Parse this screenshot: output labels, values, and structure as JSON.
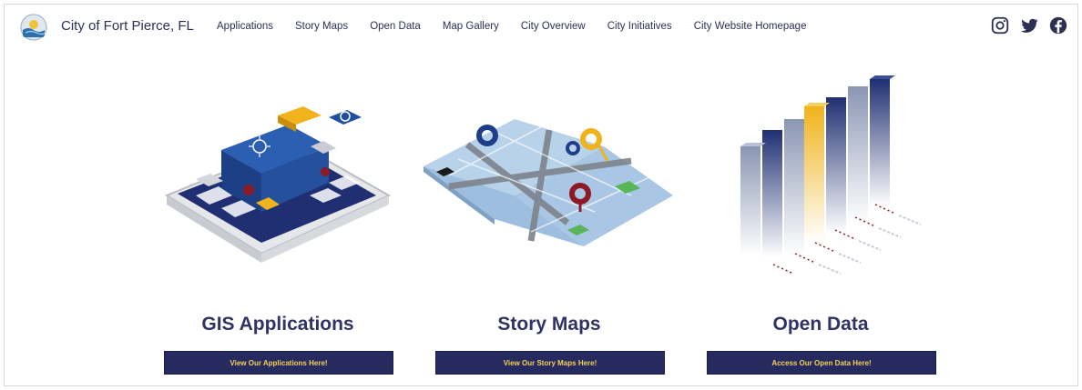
{
  "header": {
    "title": "City of Fort Pierce, FL",
    "nav": [
      "Applications",
      "Story Maps",
      "Open Data",
      "Map Gallery",
      "City Overview",
      "City Initiatives",
      "City Website Homepage"
    ],
    "social": [
      "instagram-icon",
      "twitter-icon",
      "facebook-icon"
    ]
  },
  "cards": [
    {
      "title": "GIS Applications",
      "button": "View Our Applications Here!"
    },
    {
      "title": "Story Maps",
      "button": "View Our Story Maps Here!"
    },
    {
      "title": "Open Data",
      "button": "Access Our Open Data Here!"
    }
  ],
  "colors": {
    "navy": "#262a5e",
    "accent_yellow": "#f0b31b",
    "accent_red": "#8c1a27",
    "text": "#2f3464"
  }
}
